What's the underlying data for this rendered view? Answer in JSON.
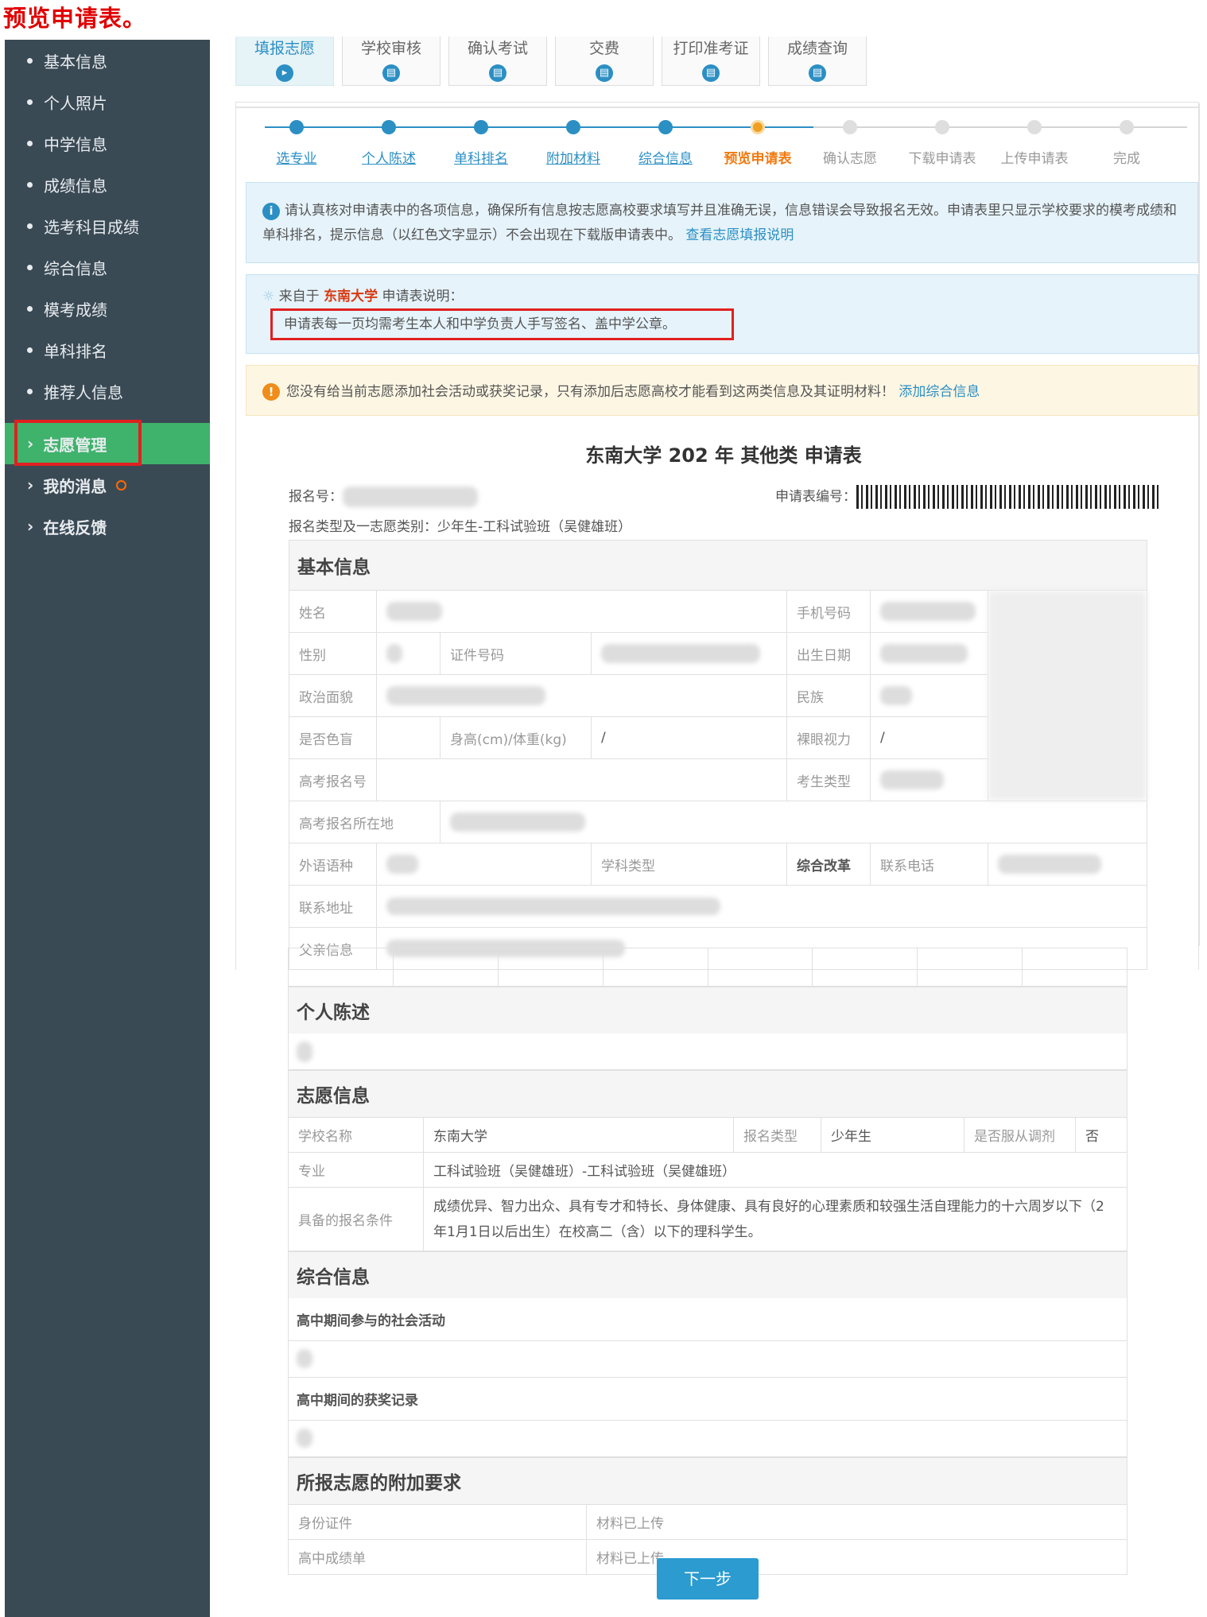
{
  "banner": "预览申请表。",
  "sidebar": {
    "items": [
      "基本信息",
      "个人照片",
      "中学信息",
      "成绩信息",
      "选考科目成绩",
      "综合信息",
      "模考成绩",
      "单科排名",
      "推荐人信息"
    ],
    "sections": [
      "志愿管理",
      "我的消息",
      "在线反馈"
    ]
  },
  "tabs": [
    "填报志愿",
    "学校审核",
    "确认考试",
    "交费",
    "打印准考证",
    "成绩查询"
  ],
  "steps": {
    "done": [
      "选专业",
      "个人陈述",
      "单科排名",
      "附加材料",
      "综合信息"
    ],
    "current": "预览申请表",
    "pending": [
      "确认志愿",
      "下载申请表",
      "上传申请表",
      "完成"
    ]
  },
  "info": {
    "text": "请认真核对申请表中的各项信息，确保所有信息按志愿高校要求填写并且准确无误，信息错误会导致报名无效。申请表里只显示学校要求的模考成绩和单科排名，提示信息（以红色文字显示）不会出现在下载版申请表中。",
    "link": "查看志愿填报说明"
  },
  "notice": {
    "prefix": "来自于",
    "school": "东南大学",
    "suffix": "申请表说明：",
    "content": "申请表每一页均需考生本人和中学负责人手写签名、盖中学公章。"
  },
  "warn": {
    "text": "您没有给当前志愿添加社会活动或获奖记录，只有添加后志愿高校才能看到这两类信息及其证明材料！",
    "link": "添加综合信息"
  },
  "form": {
    "title": "东南大学 202  年 其他类 申请表",
    "reg_no_label": "报名号：",
    "app_no_label": "申请表编号：",
    "type_line": "报名类型及一志愿类别：少年生-工科试验班（吴健雄班）"
  },
  "basic": {
    "title": "基本信息",
    "name": "姓名",
    "phone": "手机号码",
    "gender": "性别",
    "id_no": "证件号码",
    "birth": "出生日期",
    "politics": "政治面貌",
    "ethnic": "民族",
    "colorblind": "是否色盲",
    "height_weight": "身高(cm)/体重(kg)",
    "hw_value": "/",
    "vision": "裸眼视力",
    "vision_value": "/",
    "gk_no": "高考报名号",
    "stu_type": "考生类型",
    "gk_place": "高考报名所在地",
    "lang": "外语语种",
    "subject_type": "学科类型",
    "reform": "综合改革",
    "contact_phone": "联系电话",
    "address": "联系地址",
    "father": "父亲信息"
  },
  "personal": {
    "title": "个人陈述"
  },
  "wish": {
    "title": "志愿信息",
    "school_label": "学校名称",
    "school": "东南大学",
    "type_label": "报名类型",
    "type": "少年生",
    "adjust_label": "是否服从调剂",
    "adjust": "否",
    "major_label": "专业",
    "major": "工科试验班（吴健雄班）-工科试验班（吴健雄班）",
    "cond_label": "具备的报名条件",
    "cond": "成绩优异、智力出众、具有专才和特长、身体健康、具有良好的心理素质和较强生活自理能力的十六周岁以下（2  年1月1日以后出生）在校高二（含）以下的理科学生。"
  },
  "comp": {
    "title": "综合信息",
    "activity": "高中期间参与的社会活动",
    "award": "高中期间的获奖记录"
  },
  "extra": {
    "title": "所报志愿的附加要求",
    "rows": [
      {
        "item": "身份证件",
        "status": "材料已上传"
      },
      {
        "item": "高中成绩单",
        "status": "材料已上传"
      }
    ]
  },
  "next_button": "下一步"
}
